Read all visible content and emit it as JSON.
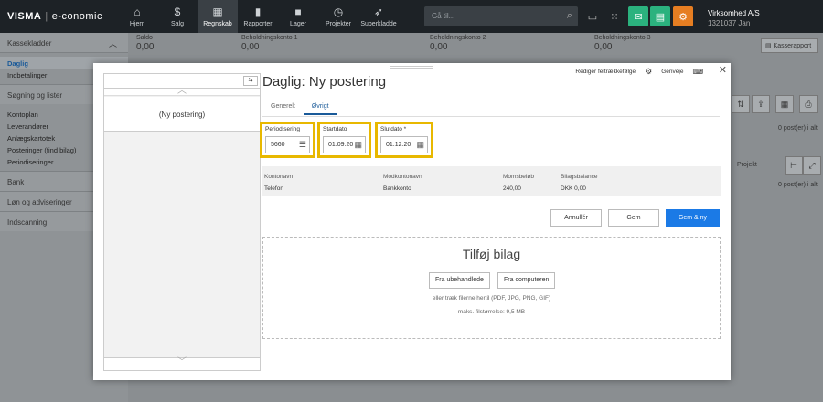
{
  "topbar": {
    "logo_brand": "VISMA",
    "logo_sep": "|",
    "logo_product": "e-conomic",
    "nav": [
      {
        "label": "Hjem",
        "icon": "home-icon"
      },
      {
        "label": "Salg",
        "icon": "dollar-icon"
      },
      {
        "label": "Regnskab",
        "icon": "calculator-icon",
        "active": true
      },
      {
        "label": "Rapporter",
        "icon": "bar-chart-icon"
      },
      {
        "label": "Lager",
        "icon": "truck-icon"
      },
      {
        "label": "Projekter",
        "icon": "clock-icon"
      },
      {
        "label": "Superkladde",
        "icon": "rocket-icon"
      }
    ],
    "search_placeholder": "Gå til...",
    "company_name": "Virksomhed A/S",
    "company_id": "1321037 Jan",
    "colors": {
      "green": "#2bb27e",
      "orange": "#e67e22"
    }
  },
  "sidebar": {
    "header": "Kassekladder",
    "items_top": [
      "Daglig",
      "Indbetalinger"
    ],
    "group1": "Søgning og lister",
    "items_mid": [
      "Kontoplan",
      "Leverandører",
      "Anlægskartotek",
      "Posteringer (find bilag)",
      "Periodiseringer"
    ],
    "groups_bottom": [
      "Bank",
      "Løn og adviseringer",
      "Indscanning"
    ]
  },
  "background": {
    "balances": [
      {
        "label": "Saldo",
        "value": "0,00"
      },
      {
        "label": "Beholdningskonto 1",
        "value": "0,00"
      },
      {
        "label": "Beholdningskonto 2",
        "value": "0,00"
      },
      {
        "label": "Beholdningskonto 3",
        "value": "0,00"
      }
    ],
    "kasserapport": "Kasserapport",
    "posts1": "0 post(er) i alt",
    "projekt": "Projekt",
    "posts2": "0 post(er) i alt"
  },
  "modal": {
    "entry": "(Ny postering)",
    "title": "Daglig: Ny postering",
    "edit_order": "Redigér feltrækkefølge",
    "genveje": "Genveje",
    "tabs": [
      "Generelt",
      "Øvrigt"
    ],
    "fields": {
      "periodisering": {
        "label": "Periodisering",
        "value": "5660"
      },
      "startdato": {
        "label": "Startdato",
        "value": "01.09.20"
      },
      "slutdato": {
        "label": "Slutdato *",
        "value": "01.12.20"
      }
    },
    "table": {
      "headers": [
        "Kontonavn",
        "Modkontonavn",
        "Momsbeløb",
        "Bilagsbalance"
      ],
      "row": [
        "Telefon",
        "Bankkonto",
        "240,00",
        "DKK 0,00"
      ]
    },
    "buttons": {
      "cancel": "Annullér",
      "save": "Gem",
      "save_new": "Gem & ny"
    },
    "attach": {
      "title": "Tilføj bilag",
      "btn_unhandled": "Fra ubehandlede",
      "btn_computer": "Fra computeren",
      "hint": "eller træk filerne hertil (PDF, JPG, PNG, GIF)",
      "maxsize": "maks. filstørrelse: 9,5 MB"
    }
  }
}
